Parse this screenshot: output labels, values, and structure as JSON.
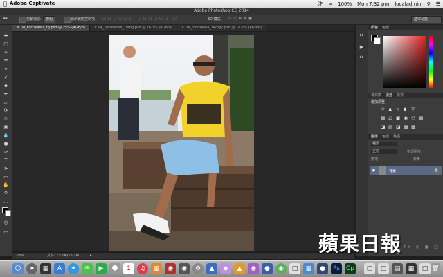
{
  "menubar": {
    "app_name": "Adobe Captivate",
    "input_method": "注",
    "battery": "100%",
    "clock": "Mon 7:32 pm",
    "user": "localadmin"
  },
  "window": {
    "title": "Adobe Photoshop CC 2014"
  },
  "options_bar": {
    "auto_select_label": "自動選取:",
    "auto_select_value": "群組",
    "transform_label": "顯示變形控制項",
    "mode_label": "3D 模式",
    "workspace": "基本功能"
  },
  "tabs": [
    {
      "label": "04_FocusArea_fg.psd @ 25% (RGB/8)",
      "active": true
    },
    {
      "label": "04_FocusArea_TWbg.psd @ 16.7% (RGB/8)",
      "active": false
    },
    {
      "label": "04_FocusArea_TWbg2.psd @ 16.7% (RGB/8)",
      "active": false
    }
  ],
  "status_bar": {
    "zoom": "25%",
    "doc_info": "文件: 15.1M/15.1M"
  },
  "panels": {
    "color_tabs": [
      "顏色",
      "色板"
    ],
    "adjust_tabs": [
      "樣式庫",
      "調整",
      "樣式"
    ],
    "adjust_title": "增加調整",
    "layer_tabs": [
      "圖層",
      "色版",
      "路徑"
    ],
    "layer_kind": "種類",
    "blend_mode": "正常",
    "opacity_label": "不透明度:",
    "lock_label": "鎖定:",
    "fill_label": "填滿:",
    "layer_name": "背景"
  },
  "watermark": "蘋果日報",
  "dock": {
    "calendar_day": "1",
    "ps_label": "Ps",
    "cp_label": "Cp"
  }
}
